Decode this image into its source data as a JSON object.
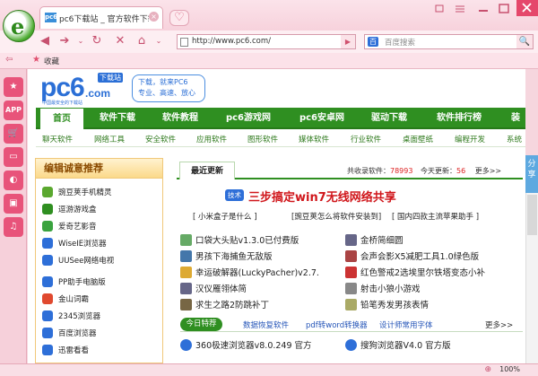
{
  "browser": {
    "logo_letter": "e",
    "tab": {
      "favicon": "pc6",
      "title": "pc6下载站 _ 官方软件下载游",
      "close": "×"
    },
    "newtab_icon": "heart-icon",
    "window_controls": [
      "pin-icon",
      "menu-icon",
      "minimize-icon",
      "maximize-icon",
      "close-icon"
    ],
    "nav_icons": [
      "back-icon",
      "forward-icon",
      "dropdown-icon",
      "refresh-icon",
      "stop-icon",
      "home-icon",
      "dropdown-icon"
    ],
    "address": {
      "url": "http://www.pc6.com/",
      "go": "▶"
    },
    "search": {
      "engine": "百",
      "placeholder": "百度搜索",
      "button": "🔍"
    },
    "bookmarks_label": "收藏",
    "zoom": "100%"
  },
  "sidebar": {
    "items": [
      {
        "label": "★",
        "color": "#e8537a"
      },
      {
        "label": "APP",
        "color": "#e8537a"
      },
      {
        "label": "🛒",
        "color": "#e8537a"
      },
      {
        "label": "▭",
        "color": "#e8537a"
      },
      {
        "label": "◐",
        "color": "#e8537a"
      },
      {
        "label": "▣",
        "color": "#e8537a"
      },
      {
        "label": "♫",
        "color": "#e8537a"
      }
    ]
  },
  "site": {
    "logo_text": "pc6",
    "logo_badge": "下载站",
    "logo_domain": ".com",
    "logo_slogan": "中国最安全的下载站",
    "slogan_lines": [
      "下载，就来PC6",
      "专业、高速、放心"
    ],
    "main_nav": [
      "首页",
      "软件下载",
      "软件教程",
      "pc6游戏网",
      "pc6安卓网",
      "驱动下载",
      "软件排行榜",
      "装"
    ],
    "sub_nav": [
      "聊天软件",
      "网络工具",
      "安全软件",
      "应用软件",
      "图形软件",
      "媒体软件",
      "行业软件",
      "桌面壁纸",
      "编程开发",
      "系统"
    ],
    "recommend": {
      "title": "编辑诚意推荐",
      "items": [
        {
          "label": "豌豆荚手机精灵",
          "color": "#5aa82f"
        },
        {
          "label": "逗游游戏盒",
          "color": "#2f8f21"
        },
        {
          "label": "爱奇艺影音",
          "color": "#3aa33f"
        },
        {
          "label": "WiseIE浏览器",
          "color": "#2e6fd8"
        },
        {
          "label": "UUSee网络电视",
          "color": "#2e6fd8"
        },
        {
          "label": "PP助手电脑版",
          "color": "#2e6fd8"
        },
        {
          "label": "金山词霸",
          "color": "#e0492f"
        },
        {
          "label": "2345浏览器",
          "color": "#2e6fd8"
        },
        {
          "label": "百度浏览器",
          "color": "#2e6fd8"
        },
        {
          "label": "迅雷看看",
          "color": "#2e6fd8"
        }
      ]
    },
    "latest": {
      "tab": "最近更新",
      "stats_label1": "共收录软件：",
      "stats_value1": "78993",
      "stats_label2": "今天更新：",
      "stats_value2": "56",
      "more": "更多>>",
      "badge": "技术",
      "headline": "三步搞定win7无线网络共享",
      "quick_links": [
        "小米盒子是什么",
        "豌豆荚怎么将软件安装到",
        "国内四款主流苹果助手"
      ],
      "software": [
        {
          "label": "口袋大头贴v1.3.0已付费版",
          "color": "#6a6"
        },
        {
          "label": "金桥简细圆",
          "color": "#668"
        },
        {
          "label": "男孩下海捕鱼无敌版",
          "color": "#47a"
        },
        {
          "label": "会声会影X5减肥工具1.0绿色版",
          "color": "#a44"
        },
        {
          "label": "幸运破解器(LuckyPacher)v2.7.",
          "color": "#da3"
        },
        {
          "label": "红色警戒2选埃里尔铁塔变态小补",
          "color": "#c33"
        },
        {
          "label": "汉仪雁翎体简",
          "color": "#668"
        },
        {
          "label": "射击小狼小游戏",
          "color": "#888"
        },
        {
          "label": "求生之路2防跳补丁",
          "color": "#764"
        },
        {
          "label": "铅笔秀发男孩表情",
          "color": "#aa6"
        }
      ],
      "today_pill": "今日特荐",
      "today_links": [
        "数据恢复软件",
        "pdf转word转换器",
        "设计师常用字体"
      ],
      "today_more": "更多>>",
      "bottom_items": [
        {
          "label": "360极速浏览器v8.0.249 官方",
          "color": "#2e6fd8"
        },
        {
          "label": "搜狗浏览器V4.0 官方版",
          "color": "#2e6fd8"
        }
      ]
    },
    "share": "分享"
  }
}
